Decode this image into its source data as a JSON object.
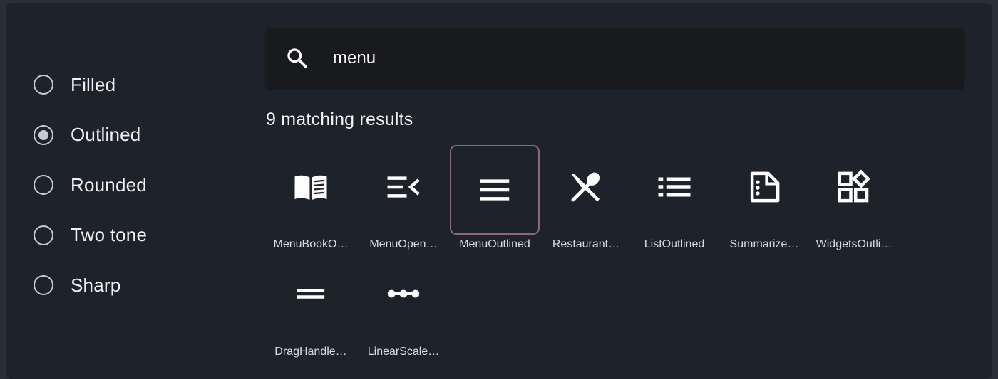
{
  "theme_options": [
    {
      "label": "Filled",
      "selected": false
    },
    {
      "label": "Outlined",
      "selected": true
    },
    {
      "label": "Rounded",
      "selected": false
    },
    {
      "label": "Two tone",
      "selected": false
    },
    {
      "label": "Sharp",
      "selected": false
    }
  ],
  "search": {
    "value": "menu",
    "icon": "search-icon"
  },
  "results": {
    "count_text": "9 matching results",
    "icons": [
      {
        "label": "MenuBookO…",
        "icon": "menu-book-icon"
      },
      {
        "label": "MenuOpen…",
        "icon": "menu-open-icon"
      },
      {
        "label": "MenuOutlined",
        "icon": "menu-icon",
        "selected": true
      },
      {
        "label": "Restaurant…",
        "icon": "restaurant-menu-icon"
      },
      {
        "label": "ListOutlined",
        "icon": "list-icon"
      },
      {
        "label": "Summarize…",
        "icon": "summarize-icon"
      },
      {
        "label": "WidgetsOutli…",
        "icon": "widgets-icon"
      },
      {
        "label": "DragHandle…",
        "icon": "drag-handle-icon"
      },
      {
        "label": "LinearScale…",
        "icon": "linear-scale-icon"
      }
    ]
  },
  "colors": {
    "panel": "#1e232b",
    "search_bg": "#181a1e",
    "selected_border": "#8a6a72"
  }
}
